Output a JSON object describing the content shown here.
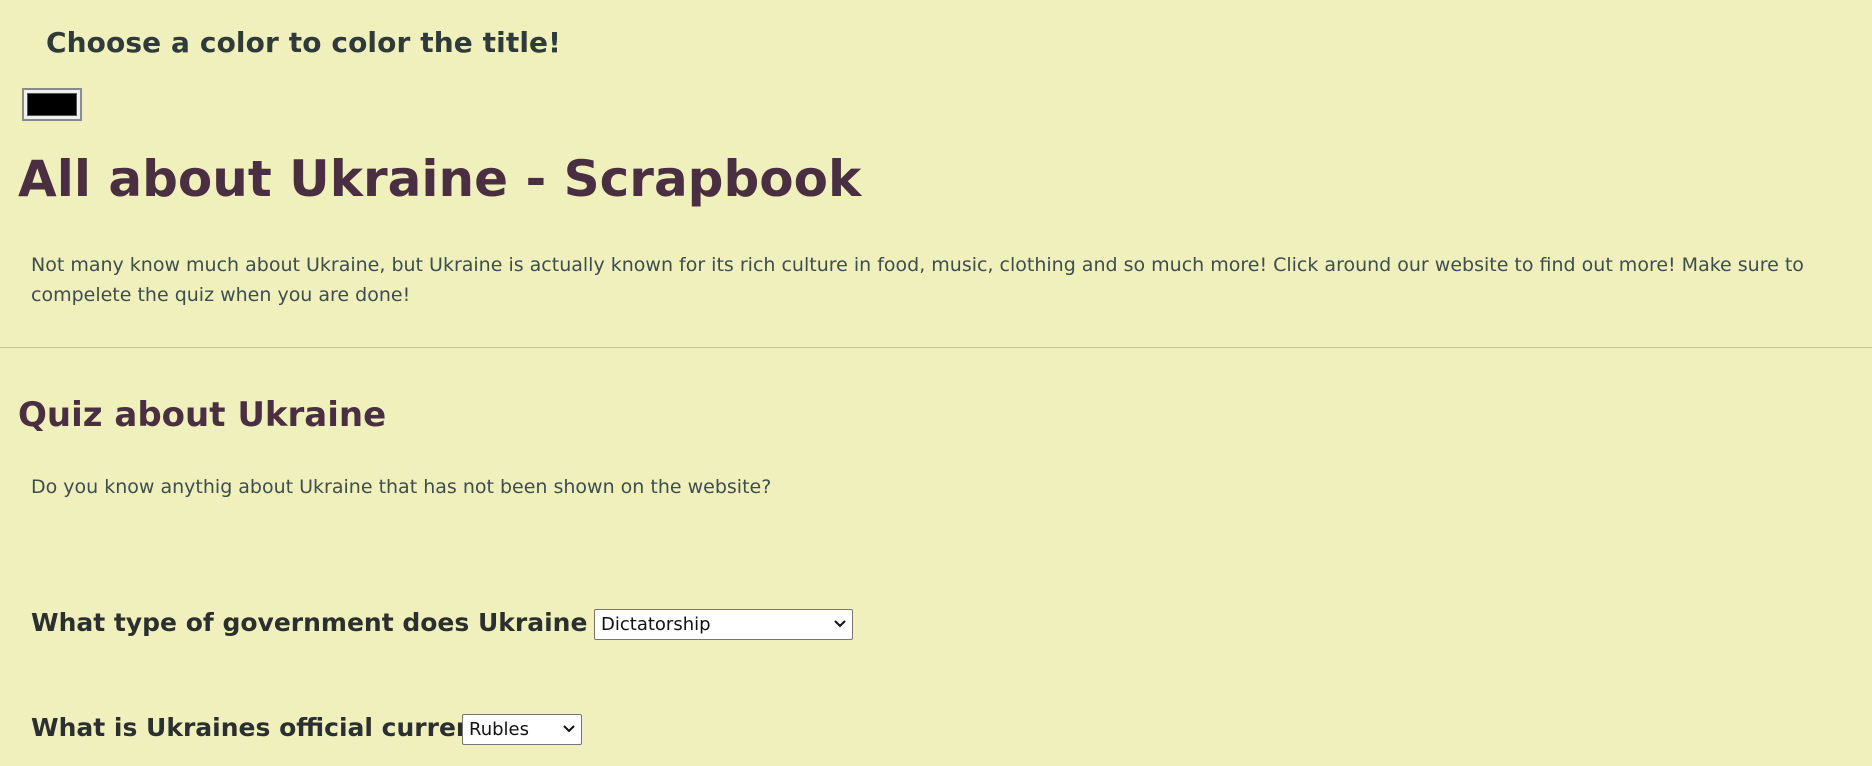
{
  "color_picker": {
    "label": "Choose a color to color the title!",
    "value": "#000000"
  },
  "header": {
    "title": "All about Ukraine - Scrapbook",
    "title_color": "#4a2f42"
  },
  "intro": {
    "text": "Not many know much about Ukraine, but Ukraine is actually known for its rich culture in food, music, clothing and so much more! Click around our website to find out more! Make sure to compelete the quiz when you are done!"
  },
  "quiz": {
    "title": "Quiz about Ukraine",
    "intro": "Do you know anythig about Ukraine that has not been shown on the website?",
    "questions": [
      {
        "label": "What type of government does Ukraine have?",
        "selected": "Dictatorship"
      },
      {
        "label": "What is Ukraines official currency?",
        "selected": "Rubles"
      }
    ]
  },
  "colors": {
    "background": "#eff0bc",
    "body_text": "#3e4d4d"
  }
}
